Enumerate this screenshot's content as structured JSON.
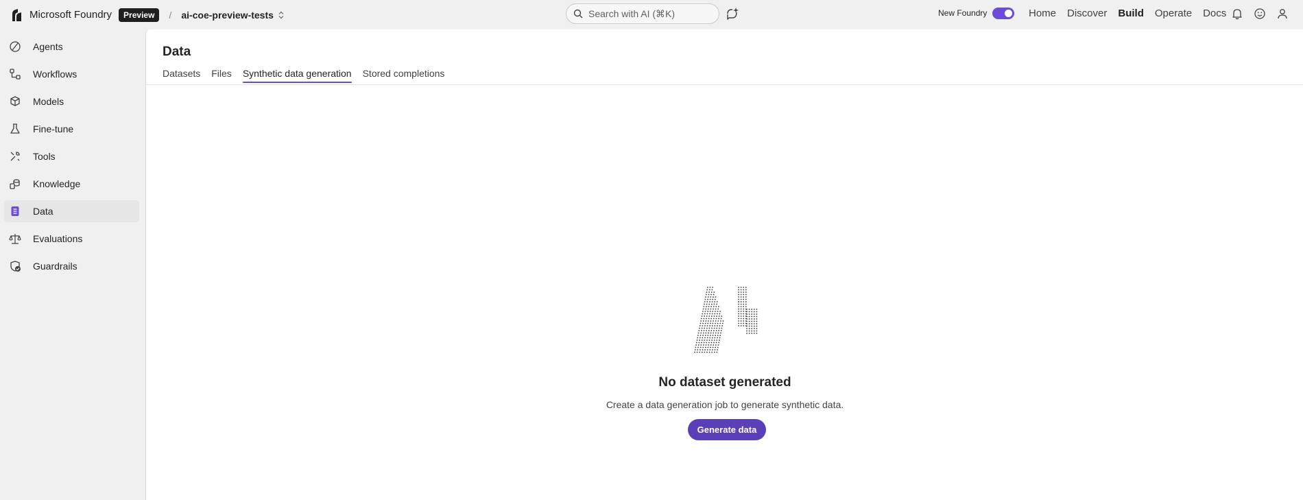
{
  "topbar": {
    "brand_name": "Microsoft Foundry",
    "preview_badge": "Preview",
    "separator": "/",
    "project_name": "ai-coe-preview-tests",
    "search_placeholder": "Search with AI (⌘K)",
    "new_foundry_label": "New Foundry",
    "new_foundry_enabled": true,
    "nav": [
      {
        "label": "Home",
        "active": false
      },
      {
        "label": "Discover",
        "active": false
      },
      {
        "label": "Build",
        "active": true
      },
      {
        "label": "Operate",
        "active": false
      },
      {
        "label": "Docs",
        "active": false
      }
    ],
    "icons": [
      "bell-icon",
      "smiley-feedback-icon",
      "user-avatar-icon"
    ]
  },
  "sidebar": {
    "items": [
      {
        "label": "Agents",
        "icon": "agents-icon",
        "active": false
      },
      {
        "label": "Workflows",
        "icon": "workflows-icon",
        "active": false
      },
      {
        "label": "Models",
        "icon": "models-icon",
        "active": false
      },
      {
        "label": "Fine-tune",
        "icon": "flask-icon",
        "active": false
      },
      {
        "label": "Tools",
        "icon": "tools-icon",
        "active": false
      },
      {
        "label": "Knowledge",
        "icon": "knowledge-icon",
        "active": false
      },
      {
        "label": "Data",
        "icon": "data-icon",
        "active": true
      },
      {
        "label": "Evaluations",
        "icon": "scales-icon",
        "active": false
      },
      {
        "label": "Guardrails",
        "icon": "shield-check-icon",
        "active": false
      }
    ]
  },
  "main": {
    "title": "Data",
    "tabs": [
      {
        "label": "Datasets",
        "active": false
      },
      {
        "label": "Files",
        "active": false
      },
      {
        "label": "Synthetic data generation",
        "active": true
      },
      {
        "label": "Stored completions",
        "active": false
      }
    ],
    "empty_state": {
      "title": "No dataset generated",
      "subtitle": "Create a data generation job to generate synthetic data.",
      "button_label": "Generate data"
    }
  },
  "colors": {
    "accent": "#6b4bd8",
    "button": "#5b3fb8",
    "background": "#f0f0f0",
    "panel": "#ffffff"
  }
}
